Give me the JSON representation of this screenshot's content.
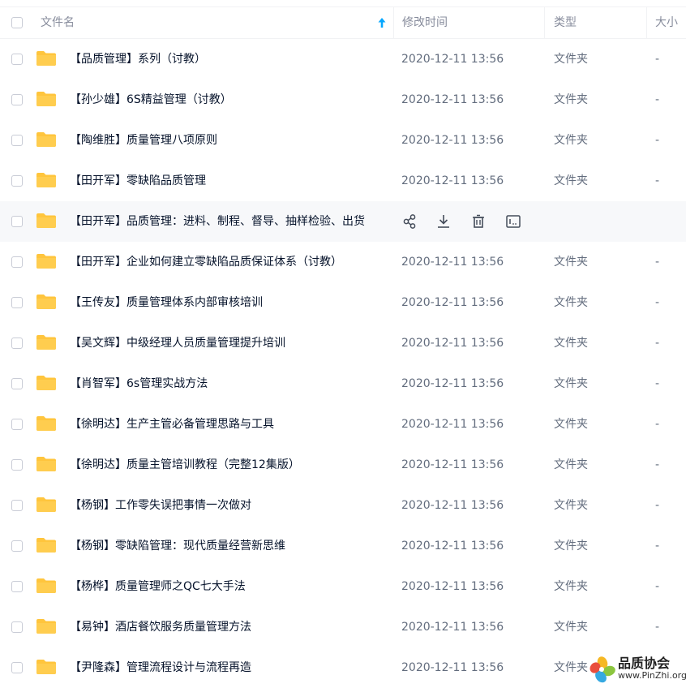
{
  "columns": {
    "name": "文件名",
    "modified": "修改时间",
    "type": "类型",
    "size": "大小"
  },
  "rows": [
    {
      "name": "【品质管理】系列（讨教）",
      "modified": "2020-12-11 13:56",
      "type": "文件夹",
      "size": "-"
    },
    {
      "name": "【孙少雄】6S精益管理（讨教）",
      "modified": "2020-12-11 13:56",
      "type": "文件夹",
      "size": "-"
    },
    {
      "name": "【陶维胜】质量管理八项原则",
      "modified": "2020-12-11 13:56",
      "type": "文件夹",
      "size": "-"
    },
    {
      "name": "【田开军】零缺陷品质管理",
      "modified": "2020-12-11 13:56",
      "type": "文件夹",
      "size": "-"
    },
    {
      "name": "【田开军】品质管理：进料、制程、督导、抽样检验、出货",
      "modified": "",
      "type": "",
      "size": ""
    },
    {
      "name": "【田开军】企业如何建立零缺陷品质保证体系（讨教）",
      "modified": "2020-12-11 13:56",
      "type": "文件夹",
      "size": "-"
    },
    {
      "name": "【王传友】质量管理体系内部审核培训",
      "modified": "2020-12-11 13:56",
      "type": "文件夹",
      "size": "-"
    },
    {
      "name": "【吴文辉】中级经理人员质量管理提升培训",
      "modified": "2020-12-11 13:56",
      "type": "文件夹",
      "size": "-"
    },
    {
      "name": "【肖智军】6s管理实战方法",
      "modified": "2020-12-11 13:56",
      "type": "文件夹",
      "size": "-"
    },
    {
      "name": "【徐明达】生产主管必备管理思路与工具",
      "modified": "2020-12-11 13:56",
      "type": "文件夹",
      "size": "-"
    },
    {
      "name": "【徐明达】质量主管培训教程（完整12集版）",
      "modified": "2020-12-11 13:56",
      "type": "文件夹",
      "size": "-"
    },
    {
      "name": "【杨钢】工作零失误把事情一次做对",
      "modified": "2020-12-11 13:56",
      "type": "文件夹",
      "size": "-"
    },
    {
      "name": "【杨钢】零缺陷管理：现代质量经营新思维",
      "modified": "2020-12-11 13:56",
      "type": "文件夹",
      "size": "-"
    },
    {
      "name": "【杨桦】质量管理师之QC七大手法",
      "modified": "2020-12-11 13:56",
      "type": "文件夹",
      "size": "-"
    },
    {
      "name": "【易钟】酒店餐饮服务质量管理方法",
      "modified": "2020-12-11 13:56",
      "type": "文件夹",
      "size": "-"
    },
    {
      "name": "【尹隆森】管理流程设计与流程再造",
      "modified": "2020-12-11 13:56",
      "type": "文件夹",
      "size": ""
    }
  ],
  "hover_actions": [
    "share-icon",
    "download-icon",
    "delete-icon",
    "rename-icon"
  ],
  "watermark": {
    "title": "品质协会",
    "url": "www.PinZhi.org"
  },
  "colors": {
    "accent": "#06a7ff",
    "folder": "#ffc53d",
    "hover_row": "#f7f8fa"
  }
}
